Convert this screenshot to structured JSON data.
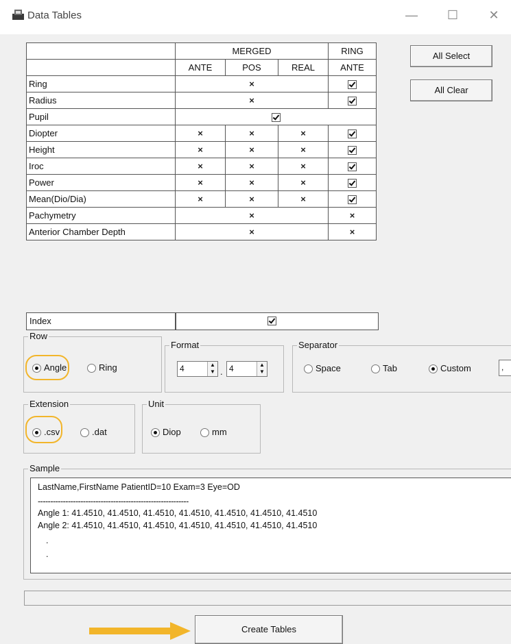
{
  "window": {
    "title": "Data Tables",
    "minimize": "—",
    "maximize": "☐",
    "close": "✕"
  },
  "grid": {
    "group_headers": [
      "MERGED",
      "RING"
    ],
    "sub_headers": [
      "ANTE",
      "POS",
      "REAL",
      "ANTE"
    ],
    "rows": [
      {
        "label": "Ring",
        "merged": "×",
        "ring": "check"
      },
      {
        "label": "Radius",
        "merged": "×",
        "ring": "check"
      },
      {
        "label": "Pupil",
        "all": "check"
      },
      {
        "label": "Diopter",
        "ante": "×",
        "pos": "×",
        "real": "×",
        "ring": "check"
      },
      {
        "label": "Height",
        "ante": "×",
        "pos": "×",
        "real": "×",
        "ring": "check"
      },
      {
        "label": "Iroc",
        "ante": "×",
        "pos": "×",
        "real": "×",
        "ring": "check"
      },
      {
        "label": "Power",
        "ante": "×",
        "pos": "×",
        "real": "×",
        "ring": "check"
      },
      {
        "label": "Mean(Dio/Dia)",
        "ante": "×",
        "pos": "×",
        "real": "×",
        "ring": "check"
      },
      {
        "label": "Pachymetry",
        "merged": "×",
        "ring": "×"
      },
      {
        "label": "Anterior Chamber Depth",
        "merged": "×",
        "ring": "×"
      }
    ]
  },
  "buttons": {
    "all_select": "All Select",
    "all_clear": "All Clear",
    "create_tables": "Create Tables"
  },
  "index": {
    "label": "Index",
    "checked": true
  },
  "row_group": {
    "title": "Row",
    "options": [
      "Angle",
      "Ring"
    ],
    "selected": "Angle"
  },
  "format_group": {
    "title": "Format",
    "value1": "4",
    "separator_dot": ".",
    "value2": "4"
  },
  "separator_group": {
    "title": "Separator",
    "options": [
      "Space",
      "Tab",
      "Custom"
    ],
    "selected": "Custom",
    "custom_value": ","
  },
  "extension_group": {
    "title": "Extension",
    "options": [
      ".csv",
      ".dat"
    ],
    "selected": ".csv"
  },
  "unit_group": {
    "title": "Unit",
    "options": [
      "Diop",
      "mm"
    ],
    "selected": "Diop"
  },
  "sample": {
    "title": "Sample",
    "lines": [
      "LastName,FirstName PatientID=10 Exam=3 Eye=OD",
      "------------------------------------------------------------",
      "Angle  1: 41.4510, 41.4510, 41.4510, 41.4510, 41.4510, 41.4510, 41.4510",
      "Angle  2: 41.4510, 41.4510, 41.4510, 41.4510, 41.4510, 41.4510, 41.4510",
      ".",
      "."
    ]
  },
  "colors": {
    "highlight": "#f2b52a",
    "arrow": "#f2b52a"
  }
}
